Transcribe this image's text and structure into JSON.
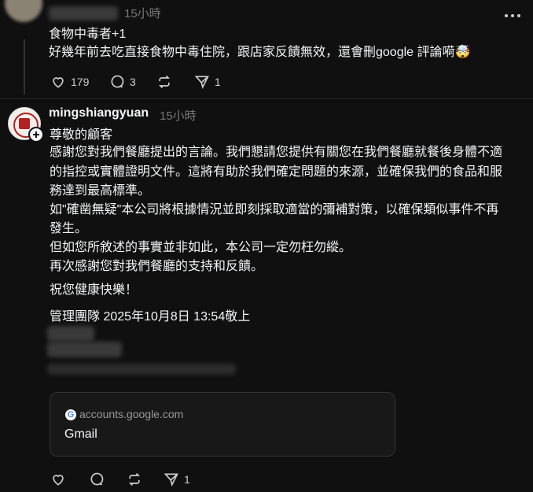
{
  "post1": {
    "author": "",
    "time": "15小時",
    "lines": [
      "食物中毒者+1",
      "好幾年前去吃直接食物中毒住院，跟店家反饋無效，還會刪google 評論嗬🤯"
    ],
    "actions": {
      "likes": "179",
      "replies": "3",
      "reposts": "",
      "shares": "1"
    }
  },
  "post2": {
    "author": "mingshiangyuan",
    "time": "15小時",
    "lines": [
      "尊敬的顧客",
      "感謝您對我們餐廳提出的言論。我們懇請您提供有關您在我們餐廳就餐後身體不適",
      "的指控或實體證明文件。這將有助於我們確定問題的來源，並確保我們的食品和服",
      "務達到最高標準。",
      "如\"確凿無疑\"本公司將根據情況並即刻採取適當的彌補對策，以確保類似事件不再",
      "發生。",
      "但如您所敘述的事實並非如此，本公司一定勿枉勿縱。",
      "再次感謝您對我們餐廳的支持和反饋。"
    ],
    "wish": "祝您健康快樂！",
    "sign": "管理團隊 2025年10月8日 13:54敬上",
    "link_card": {
      "domain": "accounts.google.com",
      "title": "Gmail"
    },
    "actions": {
      "likes": "",
      "replies": "",
      "reposts": "",
      "shares": "1"
    }
  },
  "icons": {
    "like": "heart-icon",
    "reply": "comment-icon",
    "repost": "repost-icon",
    "share": "send-icon",
    "more": "more-icon",
    "follow": "plus-icon",
    "favicon": "google-g-icon"
  },
  "colors": {
    "background": "#101010",
    "text": "#f3f5f7",
    "muted": "#777777"
  }
}
